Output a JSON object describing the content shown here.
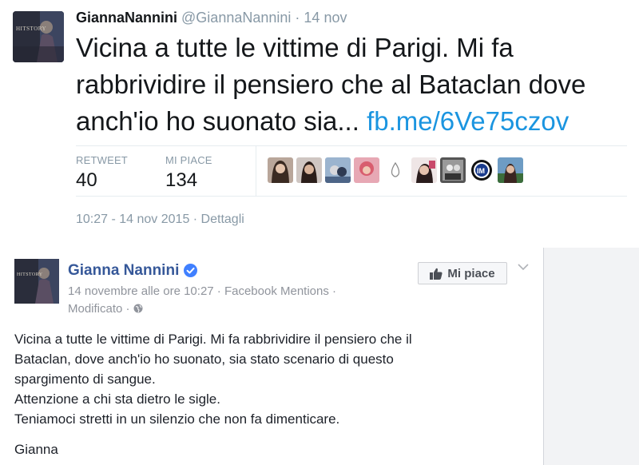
{
  "tweet": {
    "display_name": "GiannaNannini",
    "handle": "@GiannaNannini",
    "separator": "·",
    "date": "14 nov",
    "text_main": "Vicina a tutte le vittime di Parigi. Mi fa rabbrividire il pensiero che al Bataclan dove anch'io ho suonato sia... ",
    "link": "fb.me/6Ve75czov",
    "retweet_label": "RETWEET",
    "retweet_count": "40",
    "likes_label": "MI PIACE",
    "likes_count": "134",
    "timestamp": "10:27 - 14 nov 2015 · Dettagli",
    "avatar_caption": "HITSTORY",
    "colors": {
      "link": "#1b95e0",
      "muted": "#8899a6",
      "text": "#14171a"
    }
  },
  "facebook": {
    "page_name": "Gianna Nannini",
    "meta_line1": "14 novembre alle ore 10:27 · Facebook Mentions ·",
    "meta_line2": "Modificato ·",
    "like_button": "Mi piace",
    "post_lines": [
      "Vicina a tutte le vittime di Parigi. Mi fa rabbrividire il pensiero che il",
      "Bataclan, dove anch'io ho suonato, sia stato scenario di questo",
      "spargimento di sangue.",
      "Attenzione a chi sta dietro le sigle.",
      "Teniamoci stretti in un silenzio che non fa dimenticare."
    ],
    "signature": "Gianna",
    "avatar_caption": "HITSTORY",
    "colors": {
      "name": "#365899",
      "verified": "#4080ff",
      "muted": "#90949c"
    }
  }
}
